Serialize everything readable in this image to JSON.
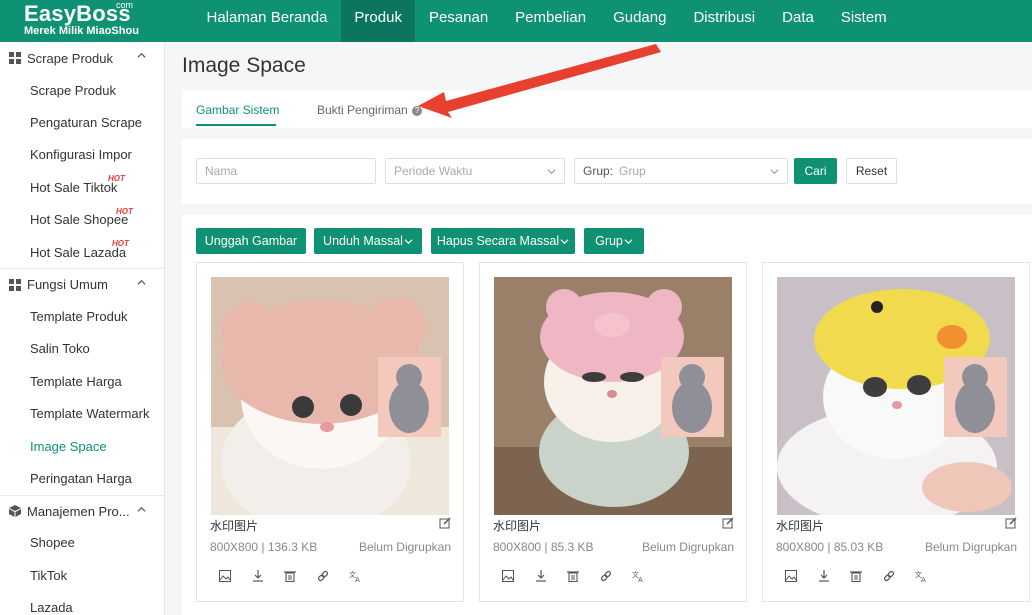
{
  "brand": {
    "name": "EasyBoss",
    "domain_suffix": "com",
    "tagline": "Merek Milik MiaoShou",
    "color": "#0f9173"
  },
  "topnav": [
    {
      "label": "Halaman Beranda",
      "active": false
    },
    {
      "label": "Produk",
      "active": true
    },
    {
      "label": "Pesanan",
      "active": false
    },
    {
      "label": "Pembelian",
      "active": false
    },
    {
      "label": "Gudang",
      "active": false
    },
    {
      "label": "Distribusi",
      "active": false
    },
    {
      "label": "Data",
      "active": false
    },
    {
      "label": "Sistem",
      "active": false
    }
  ],
  "sidebar": {
    "groups": [
      {
        "label": "Scrape Produk",
        "icon": "grid-icon",
        "items": [
          {
            "label": "Scrape Produk"
          },
          {
            "label": "Pengaturan Scrape"
          },
          {
            "label": "Konfigurasi Impor"
          },
          {
            "label": "Hot Sale Tiktok",
            "badge": "HOT"
          },
          {
            "label": "Hot Sale Shopee",
            "badge": "HOT"
          },
          {
            "label": "Hot Sale Lazada",
            "badge": "HOT"
          }
        ]
      },
      {
        "label": "Fungsi Umum",
        "icon": "grid-icon",
        "items": [
          {
            "label": "Template Produk"
          },
          {
            "label": "Salin Toko"
          },
          {
            "label": "Template Harga"
          },
          {
            "label": "Template Watermark"
          },
          {
            "label": "Image Space",
            "active": true
          },
          {
            "label": "Peringatan Harga"
          }
        ]
      },
      {
        "label": "Manajemen Pro...",
        "icon": "box-icon",
        "items": [
          {
            "label": "Shopee"
          },
          {
            "label": "TikTok"
          },
          {
            "label": "Lazada"
          }
        ]
      }
    ]
  },
  "page": {
    "title": "Image Space"
  },
  "tabs": [
    {
      "label": "Gambar Sistem",
      "active": true
    },
    {
      "label": "Bukti Pengiriman",
      "active": false,
      "help": "?"
    }
  ],
  "filters": {
    "name_placeholder": "Nama",
    "period_placeholder": "Periode Waktu",
    "group_label": "Grup:",
    "group_placeholder": "Grup",
    "search_label": "Cari",
    "reset_label": "Reset"
  },
  "actions": [
    {
      "label": "Unggah Gambar",
      "dropdown": false
    },
    {
      "label": "Unduh Massal",
      "dropdown": true
    },
    {
      "label": "Hapus Secara Massal",
      "dropdown": true
    },
    {
      "label": "Grup",
      "dropdown": true
    }
  ],
  "images": [
    {
      "name": "水印图片",
      "size": "800X800 | 136.3 KB",
      "status": "Belum Digrupkan",
      "hat": "#e8b8ac",
      "bg": "#d9c3b0"
    },
    {
      "name": "水印图片",
      "size": "800X800 | 85.3 KB",
      "status": "Belum Digrupkan",
      "hat": "#efb7c4",
      "bg": "#9a8069"
    },
    {
      "name": "水印图片",
      "size": "800X800 | 85.03 KB",
      "status": "Belum Digrupkan",
      "hat": "#f1da4d",
      "bg": "#c9bfc6"
    }
  ],
  "card_actions": [
    "image-icon",
    "download-icon",
    "delete-icon",
    "link-icon",
    "translate-icon"
  ],
  "annotation": {
    "color": "#e8402e"
  }
}
